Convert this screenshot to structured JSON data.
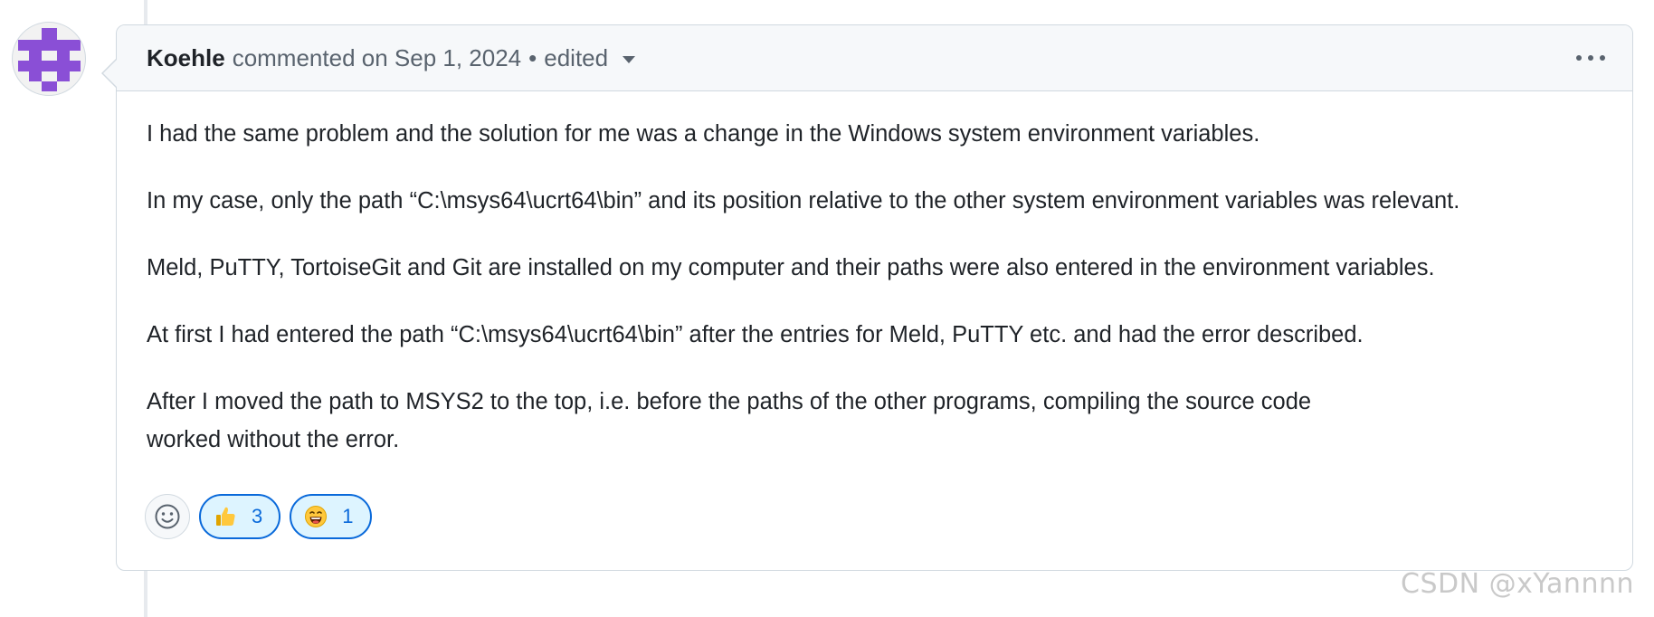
{
  "comment": {
    "author": "Koehle",
    "action_text": "commented on",
    "date": "Sep 1, 2024",
    "separator": "•",
    "edited_label": "edited",
    "paragraphs": [
      "I had the same problem and the solution for me was a change in the Windows system environment variables.",
      "In my case, only the path “C:\\msys64\\ucrt64\\bin” and its position relative to the other system environment variables was relevant.",
      "Meld, PuTTY, TortoiseGit and Git are installed on my computer and their paths were also entered in the environment variables.",
      "At first I had entered the path “C:\\msys64\\ucrt64\\bin” after the entries for Meld, PuTTY etc. and had the error described.",
      "After I moved the path to MSYS2 to the top, i.e. before the paths of the other programs, compiling the source code worked without the error."
    ]
  },
  "reactions": [
    {
      "icon": "thumbs-up-icon",
      "count": "3"
    },
    {
      "icon": "grinning-face-icon",
      "count": "1"
    }
  ],
  "avatar": {
    "icon": "identicon",
    "color": "#8a4fd6"
  },
  "watermark": "CSDN @xYannnn",
  "colors": {
    "border": "#d1d9e0",
    "header_bg": "#f6f8fa",
    "reaction_border": "#0969da",
    "reaction_bg": "#ddf4ff",
    "text": "#1f2328",
    "muted": "#59636e"
  }
}
